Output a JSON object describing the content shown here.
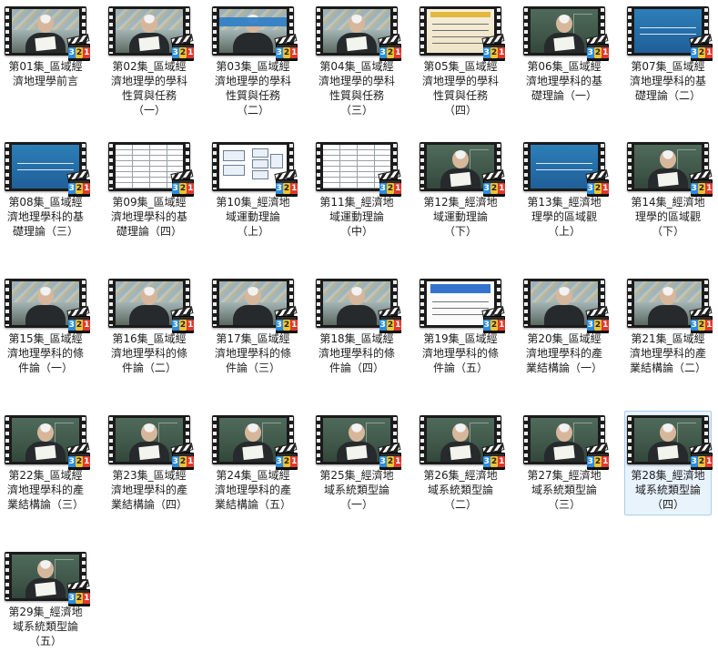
{
  "explorer": {
    "view_mode": "large-icons",
    "selected_index": 27,
    "player_icon_label": "321",
    "items": [
      {
        "label": "第01集_區域經濟地理學前言",
        "thumb": "lecture-paper"
      },
      {
        "label": "第02集_區域經濟地理學的學科性質與任務（一）",
        "thumb": "lecture-paper"
      },
      {
        "label": "第03集_區域經濟地理學的學科性質與任務（二）",
        "thumb": "lecture-banner"
      },
      {
        "label": "第04集_區域經濟地理學的學科性質與任務（三）",
        "thumb": "lecture-paper"
      },
      {
        "label": "第05集_區域經濟地理學的學科性質與任務（四）",
        "thumb": "slide-text"
      },
      {
        "label": "第06集_區域經濟地理學科的基礎理論（一）",
        "thumb": "board"
      },
      {
        "label": "第07集_區域經濟地理學科的基礎理論（二）",
        "thumb": "slide-blue"
      },
      {
        "label": "第08集_區域經濟地理學科的基礎理論（三）",
        "thumb": "slide-blue"
      },
      {
        "label": "第09集_區域經濟地理學科的基礎理論（四）",
        "thumb": "table"
      },
      {
        "label": "第10集_經濟地域運動理論（上）",
        "thumb": "diagram"
      },
      {
        "label": "第11集_經濟地域運動理論（中）",
        "thumb": "table"
      },
      {
        "label": "第12集_經濟地域運動理論（下）",
        "thumb": "board"
      },
      {
        "label": "第13集_經濟地理學的區域觀（上）",
        "thumb": "slide-blue"
      },
      {
        "label": "第14集_經濟地理學的區域觀（下）",
        "thumb": "board"
      },
      {
        "label": "第15集_區域經濟地理學科的條件論（一）",
        "thumb": "lecture"
      },
      {
        "label": "第16集_區域經濟地理學科的條件論（二）",
        "thumb": "lecture"
      },
      {
        "label": "第17集_區域經濟地理學科的條件論（三）",
        "thumb": "lecture"
      },
      {
        "label": "第18集_區域經濟地理學科的條件論（四）",
        "thumb": "lecture"
      },
      {
        "label": "第19集_區域經濟地理學科的條件論（五）",
        "thumb": "slide-white"
      },
      {
        "label": "第20集_區域經濟地理學科的產業結構論（一）",
        "thumb": "lecture"
      },
      {
        "label": "第21集_區域經濟地理學科的產業結構論（二）",
        "thumb": "lecture"
      },
      {
        "label": "第22集_區域經濟地理學科的產業結構論（三）",
        "thumb": "board"
      },
      {
        "label": "第23集_區域經濟地理學科的產業結構論（四）",
        "thumb": "board"
      },
      {
        "label": "第24集_區域經濟地理學科的產業結構論（五）",
        "thumb": "board"
      },
      {
        "label": "第25集_經濟地域系統類型論（一）",
        "thumb": "board"
      },
      {
        "label": "第26集_經濟地域系統類型論（二）",
        "thumb": "board"
      },
      {
        "label": "第27集_經濟地域系統類型論（三）",
        "thumb": "board"
      },
      {
        "label": "第28集_經濟地域系統類型論（四）",
        "thumb": "board"
      },
      {
        "label": "第29集_經濟地域系統類型論（五）",
        "thumb": "board"
      }
    ]
  }
}
